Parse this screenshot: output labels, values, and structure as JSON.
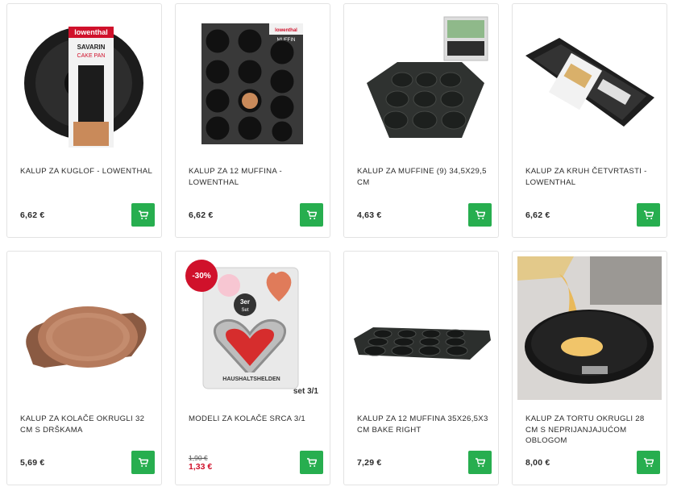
{
  "currency_note": "€",
  "colors": {
    "cart_button": "#27ae4f",
    "sale": "#d0112b",
    "border": "#e3e3e3"
  },
  "products": [
    {
      "title": "KALUP ZA KUGLOF - LOWENTHAL",
      "price": "6,62 €",
      "image": "bundt-cake-pan",
      "packaging_text": [
        "lowenthal",
        "SAVARIN",
        "CAKE PAN"
      ]
    },
    {
      "title": "KALUP ZA 12 MUFFINA - LOWENTHAL",
      "price": "6,62 €",
      "image": "12-muffin-pan-boxed",
      "packaging_text": [
        "lowenthal",
        "MUFFIN"
      ]
    },
    {
      "title": "KALUP ZA MUFFINE (9) 34,5x29,5 CM",
      "price": "4,63 €",
      "image": "9-muffin-pan"
    },
    {
      "title": "KALUP ZA KRUH ČETVRTASTI - LOWENTHAL",
      "price": "6,62 €",
      "image": "loaf-pan"
    },
    {
      "title": "KALUP ZA KOLAČE OKRUGLI 32 CM S DRŠKAMA",
      "price": "5,69 €",
      "image": "round-tart-pan-copper"
    },
    {
      "title": "MODELI ZA KOLAČE SRCA 3/1",
      "old_price": "1,90 €",
      "sale_price": "1,33 €",
      "badge": "-30%",
      "image": "heart-cookie-cutters",
      "packaging_text": [
        "3er",
        "Set",
        "HAUSHALTSHELDEN"
      ],
      "set_label": "set 3/1"
    },
    {
      "title": "KALUP ZA 12 MUFFINA 35x26,5x3 CM BAKE RIGHT",
      "price": "7,29 €",
      "image": "12-muffin-tray"
    },
    {
      "title": "KALUP ZA TORTU OKRUGLI 28 CM S NEPRIJANJAJUĆOM OBLOGOM",
      "price": "8,00 €",
      "image": "springform-pan-batter"
    }
  ]
}
